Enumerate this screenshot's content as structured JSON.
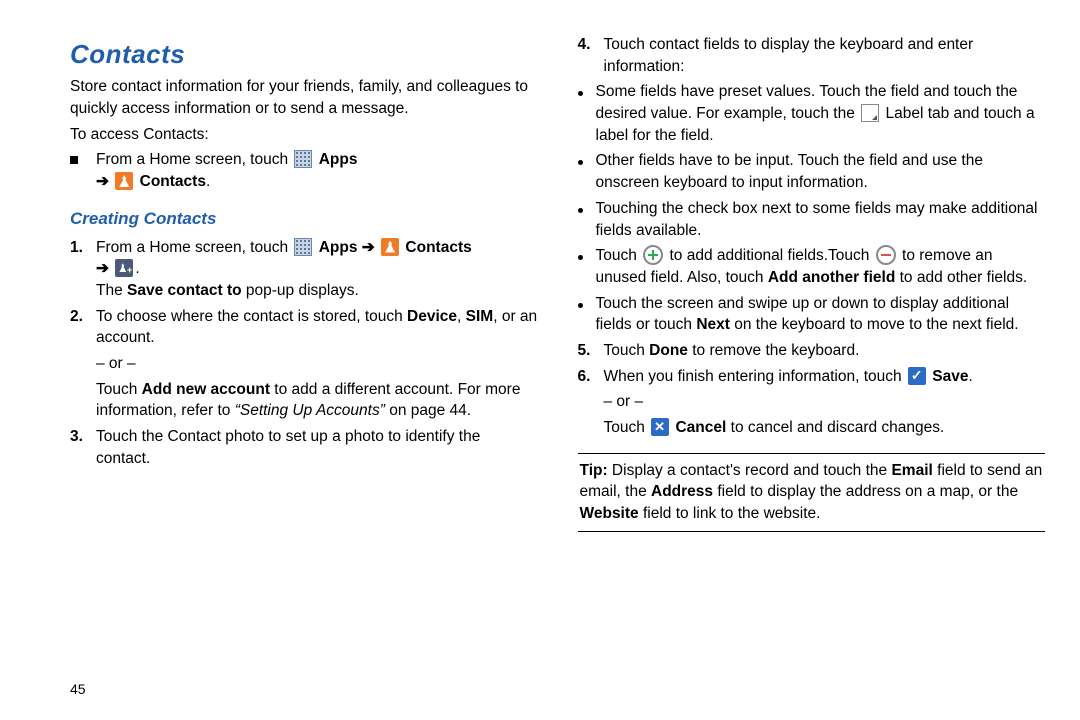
{
  "page_number": "45",
  "title": "Contacts",
  "intro": "Store contact information for your friends, family, and colleagues to quickly access information or to send a message.",
  "access_label": "To access Contacts:",
  "access_step_prefix": "From a Home screen, touch ",
  "apps_label": "Apps",
  "arrow": "➔",
  "contacts_label": "Contacts",
  "period": ".",
  "sub_title": "Creating Contacts",
  "step1_prefix": "From a Home screen, touch ",
  "step1_popup": "The ",
  "step1_popup_bold": "Save contact to",
  "step1_popup_suffix": " pop-up displays.",
  "step2_a": "To choose where the contact is stored, touch ",
  "step2_device": "Device",
  "step2_b": ", ",
  "step2_sim": "SIM",
  "step2_c": ", or an account.",
  "or_label": "– or –",
  "step2_d": "Touch ",
  "step2_add": "Add new account",
  "step2_e": " to add a different account. For more information, refer to ",
  "step2_ref": "“Setting Up Accounts”",
  "step2_f": " on page 44.",
  "step3": "Touch the Contact photo to set up a photo to identify the contact.",
  "step4": "Touch contact fields to display the keyboard and enter information:",
  "b1_a": "Some fields have preset values. Touch the field and touch the desired value. For example, touch the ",
  "b1_b": " Label tab and touch a label for the field.",
  "b2": "Other fields have to be input. Touch the field and use the onscreen keyboard to input information.",
  "b3": "Touching the check box next to some fields may make additional fields available.",
  "b4_a": "Touch ",
  "b4_b": " to add additional fields.Touch ",
  "b4_c": " to remove an unused field. Also, touch ",
  "b4_add_field": "Add another field",
  "b4_d": " to add other fields.",
  "b5_a": "Touch the screen and swipe up or down to display additional fields or touch ",
  "b5_next": "Next",
  "b5_b": " on the keyboard to move to the next field.",
  "step5_a": "Touch ",
  "step5_done": "Done",
  "step5_b": " to remove the keyboard.",
  "step6_a": "When you finish entering information, touch ",
  "step6_save": "Save",
  "step6_b": ".",
  "step6_c": "Touch ",
  "step6_cancel": "Cancel",
  "step6_d": " to cancel and discard changes.",
  "tip_label": "Tip:",
  "tip_a": " Display a contact's record and touch the ",
  "tip_email": "Email",
  "tip_b": " field to send an email, the ",
  "tip_address": "Address",
  "tip_c": " field to display the address on a map, or the ",
  "tip_website": "Website",
  "tip_d": " field to link to the website.",
  "markers": {
    "n1": "1.",
    "n2": "2.",
    "n3": "3.",
    "n4": "4.",
    "n5": "5.",
    "n6": "6."
  }
}
